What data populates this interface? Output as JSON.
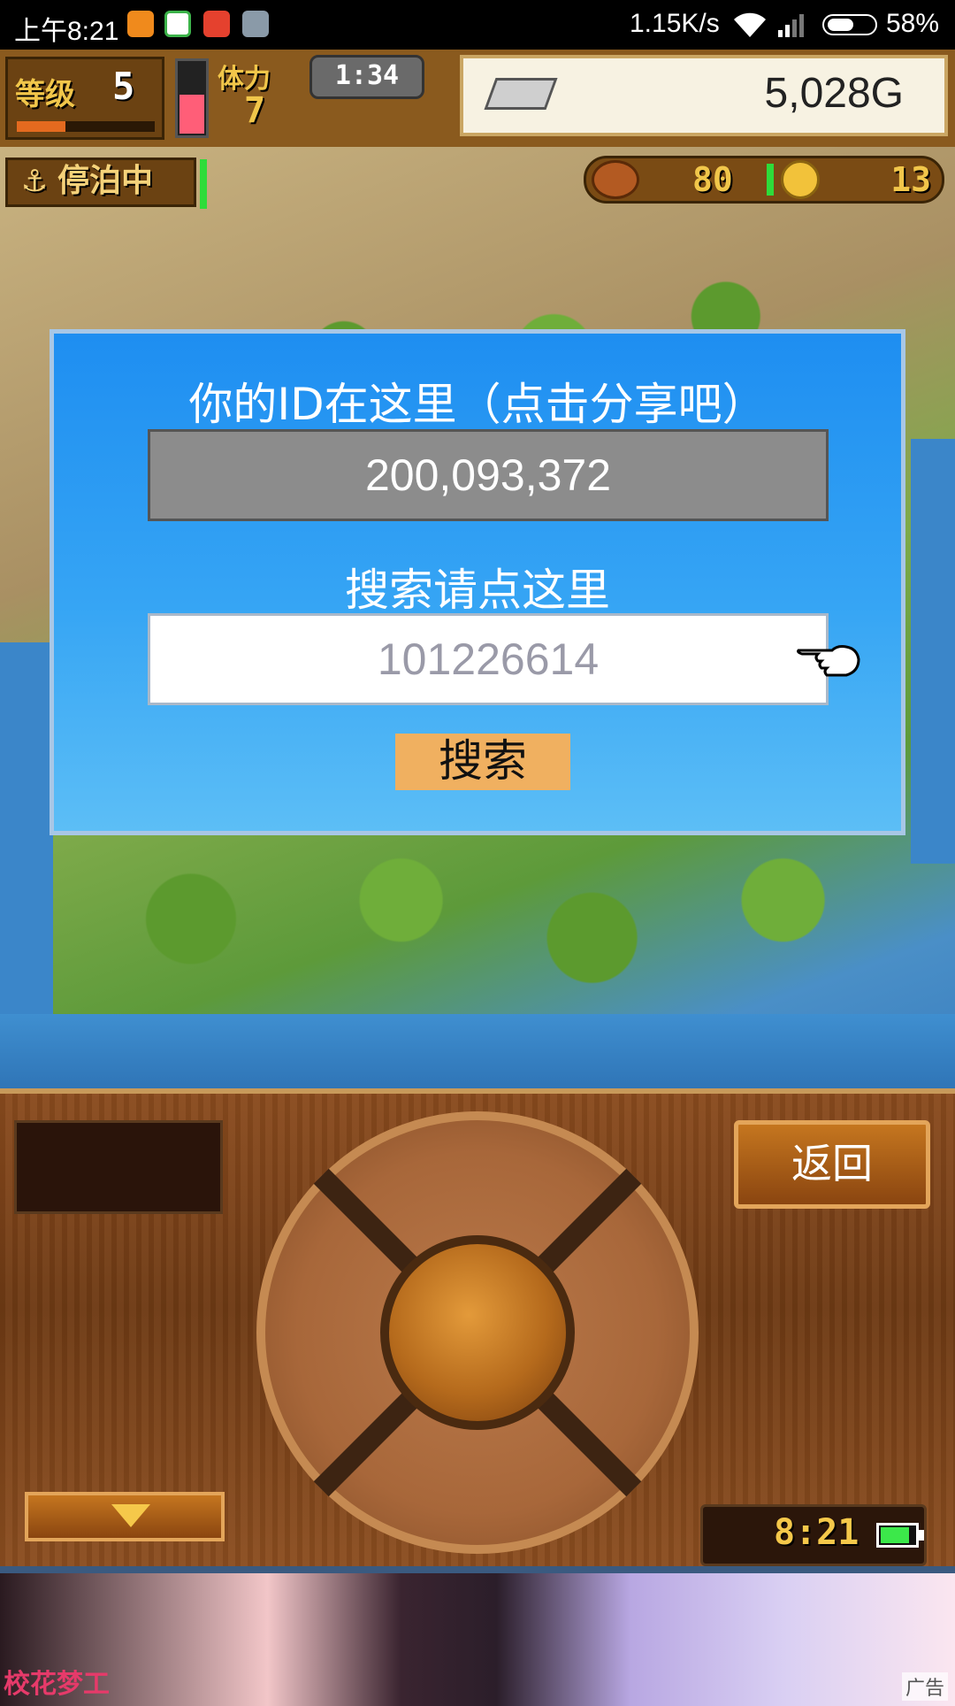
{
  "status_bar": {
    "time": "上午8:21",
    "network_speed": "1.15K/s",
    "battery_percent": "58%",
    "battery_level": 0.58,
    "notification_icons": [
      "uc-browser-icon",
      "pinwheel-app-icon",
      "sogou-icon",
      "notes-icon"
    ]
  },
  "hud": {
    "level_label": "等级",
    "level_value": "5",
    "xp_progress": 0.35,
    "stamina_label": "体力",
    "stamina_value": "7",
    "stamina_level": 0.55,
    "timer": "1:34",
    "gold": "5,028G"
  },
  "map_ui": {
    "anchor_status": "停泊中",
    "food_count": "80",
    "coin_count": "13"
  },
  "dialog": {
    "title": "你的ID在这里（点击分享吧）",
    "player_id": "200,093,372",
    "search_label": "搜索请点这里",
    "search_placeholder": "101226614",
    "search_button": "搜索"
  },
  "controls": {
    "back_button": "返回",
    "clock": "8:21",
    "battery_level": 0.85
  },
  "ad": {
    "logo_text": "校花梦工",
    "ad_label": "广告"
  },
  "colors": {
    "dialog_blue": "#1e8ef1",
    "search_button": "#f0b060",
    "hud_gold": "#f1c64a"
  }
}
